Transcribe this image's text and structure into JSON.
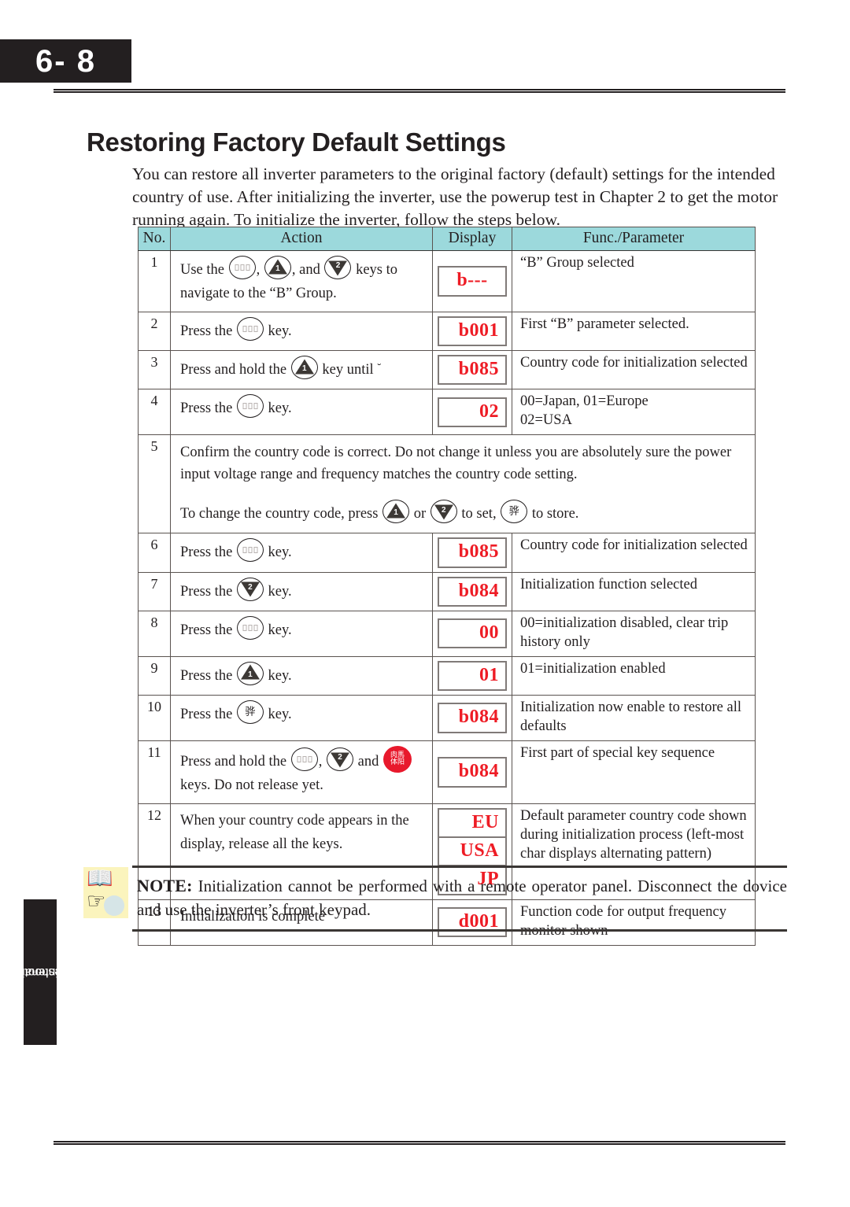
{
  "page": {
    "number": "6- 8",
    "section_title": "Restoring Factory Default Settings",
    "intro": "You can restore all inverter parameters to the original factory (default) settings for the intended country of use. After initializing the inverter, use the powerup test in Chapter 2 to get the motor running again. To initialize the inverter, follow the steps below.",
    "side_tab": "Troubleshooting and\nMaintenance"
  },
  "table": {
    "header_bg": "#9cd9dc",
    "columns": [
      "No.",
      "Action",
      "Display",
      "Func./Parameter"
    ],
    "rows": [
      {
        "no": "1",
        "action_parts": [
          "Use the ",
          "func-key",
          ", ",
          "up-key",
          ", and ",
          "down-key",
          " keys to navigate to the “B” Group."
        ],
        "display": [
          "b---"
        ],
        "display_align": "center",
        "func": "“B” Group selected"
      },
      {
        "no": "2",
        "action_parts": [
          "Press the ",
          "func-key",
          " key."
        ],
        "display": [
          "b001"
        ],
        "func": "First “B” parameter selected."
      },
      {
        "no": "3",
        "action_parts": [
          "Press and hold the ",
          "up-key",
          " key until ",
          "caret"
        ],
        "display": [
          "b085"
        ],
        "func": "Country code for initialization selected"
      },
      {
        "no": "4",
        "action_parts": [
          "Press the ",
          "func-key",
          " key."
        ],
        "display": [
          "02"
        ],
        "func": "00=Japan, 01=Europe\n02=USA"
      },
      {
        "no": "5",
        "wide": true,
        "text_line_1": "Confirm the country code is correct. Do not change it unless you are absolutely sure the power input voltage range and frequency matches the country code setting.",
        "text_line_2_parts": [
          "To change the country code, press ",
          "up-key",
          " or ",
          "down-key",
          " to set, ",
          "str-key",
          " to store."
        ]
      },
      {
        "no": "6",
        "action_parts": [
          "Press the ",
          "func-key",
          " key."
        ],
        "display": [
          "b085"
        ],
        "func": "Country code for initialization selected"
      },
      {
        "no": "7",
        "action_parts": [
          "Press the ",
          "down-key",
          " key."
        ],
        "display": [
          "b084"
        ],
        "func": "Initialization function selected"
      },
      {
        "no": "8",
        "action_parts": [
          "Press the ",
          "func-key",
          " key."
        ],
        "display": [
          "00"
        ],
        "func": "00=initialization disabled, clear trip history only"
      },
      {
        "no": "9",
        "action_parts": [
          "Press the ",
          "up-key",
          " key."
        ],
        "display": [
          "01"
        ],
        "func": "01=initialization enabled"
      },
      {
        "no": "10",
        "action_parts": [
          "Press the ",
          "str-key",
          " key."
        ],
        "display": [
          "b084"
        ],
        "func": "Initialization now enable to restore all defaults"
      },
      {
        "no": "11",
        "action_parts": [
          "Press and hold the ",
          "func-key",
          ", ",
          "down-key",
          " and ",
          "stop-key",
          " keys. Do not release yet."
        ],
        "display": [
          "b084"
        ],
        "func": "First part of special key sequence"
      },
      {
        "no": "12",
        "action_parts": [
          "When your country code appears in the display, release all the keys."
        ],
        "display": [
          "EU",
          "USA",
          "JP"
        ],
        "func": "Default parameter country code shown during initialization process (left-most char displays alternating pattern)"
      },
      {
        "no": "13",
        "action_parts": [
          "Initialization is complete"
        ],
        "display": [
          "d001"
        ],
        "func": "Function code for output frequency monitor shown"
      }
    ]
  },
  "note": {
    "label": "NOTE:",
    "text": " Initialization cannot be performed with a remote operator panel. Disconnect the dovice and use the inverter’s front keypad."
  },
  "colors": {
    "led_text": "#ee1c25",
    "header_fill": "#9cd9dc",
    "ink": "#231f20",
    "stop_key": "#e8192c",
    "note_icon_bg": "#fbf4bd"
  }
}
